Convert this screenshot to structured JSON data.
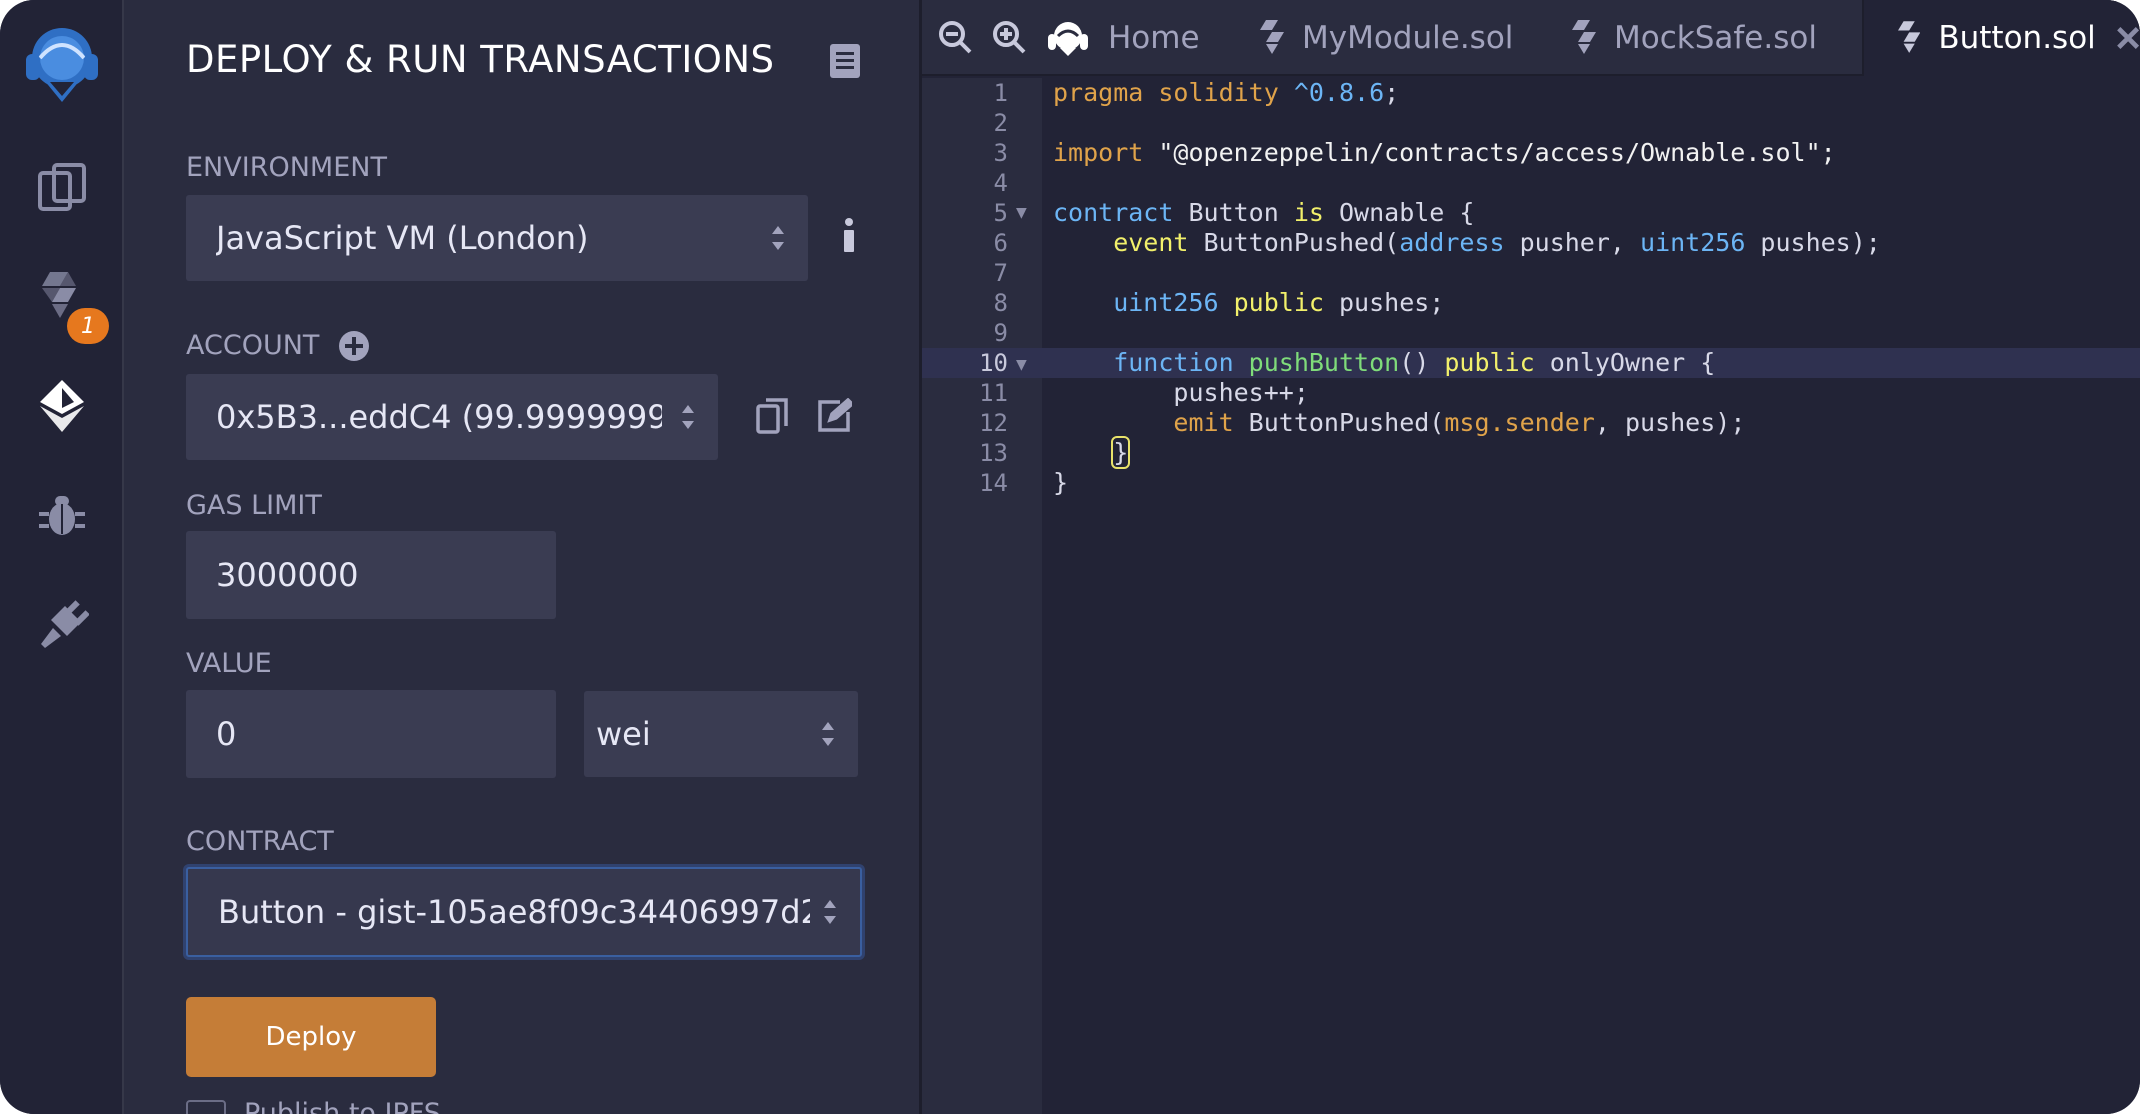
{
  "panel": {
    "title": "DEPLOY & RUN TRANSACTIONS",
    "environment": {
      "label": "ENVIRONMENT",
      "value": "JavaScript VM (London)"
    },
    "account": {
      "label": "ACCOUNT",
      "value": "0x5B3...eddC4 (99.9999999"
    },
    "gas_limit": {
      "label": "GAS LIMIT",
      "value": "3000000"
    },
    "value": {
      "label": "VALUE",
      "amount": "0",
      "unit": "wei"
    },
    "contract": {
      "label": "CONTRACT",
      "value": "Button - gist-105ae8f09c34406997d2"
    },
    "deploy_label": "Deploy",
    "publish_label": "Publish to IPFS"
  },
  "iconbar": {
    "badge": "1",
    "accent": "#2f6fc4"
  },
  "tabs": [
    {
      "label": "Home"
    },
    {
      "label": "MyModule.sol"
    },
    {
      "label": "MockSafe.sol"
    },
    {
      "label": "Button.sol"
    }
  ],
  "code": {
    "line_numbers": [
      "1",
      "2",
      "3",
      "4",
      "5",
      "6",
      "7",
      "8",
      "9",
      "10",
      "11",
      "12",
      "13",
      "14"
    ],
    "l1": {
      "a": "pragma solidity",
      "b": " ^0.8.6",
      "c": ";"
    },
    "l3": {
      "a": "import",
      "b": " \"@openzeppelin/contracts/access/Ownable.sol\";"
    },
    "l5": {
      "a": "contract",
      "b": " Button ",
      "c": "is",
      "d": " Ownable {"
    },
    "l6": {
      "a": "    event",
      "b": " ButtonPushed(",
      "c": "address",
      "d": " pusher, ",
      "e": "uint256",
      "f": " pushes);"
    },
    "l8": {
      "a": "    uint256",
      "b": " public",
      "c": " pushes;"
    },
    "l10": {
      "a": "    function",
      "b": " pushButton",
      "c": "() ",
      "d": "public",
      "e": " onlyOwner {"
    },
    "l11": {
      "a": "        pushes++;"
    },
    "l12": {
      "a": "        emit",
      "b": " ButtonPushed(",
      "c": "msg.sender",
      "d": ", pushes);"
    },
    "l13": {
      "a": "    ",
      "b": "}"
    },
    "l14": {
      "a": "}"
    }
  },
  "colors": {
    "deploy": "#c57d37",
    "badge": "#e6781e",
    "panel_bg": "#2a2c3f",
    "editor_bg": "#222336"
  }
}
